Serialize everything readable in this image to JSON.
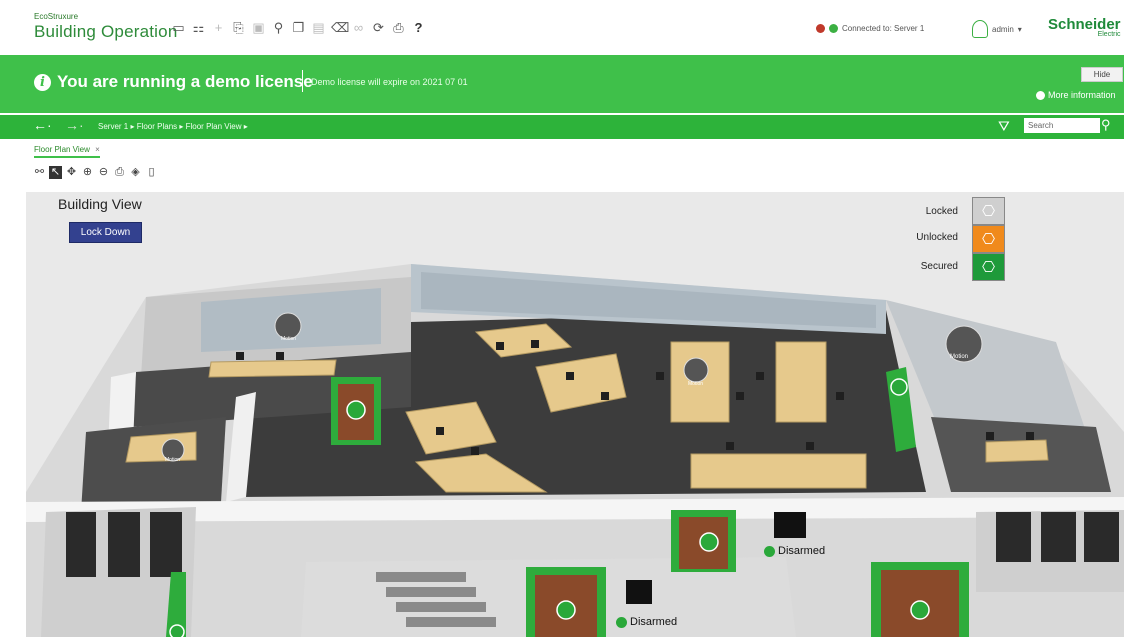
{
  "header": {
    "brand_small": "EcoStruxure",
    "brand": "Building Operation",
    "connection": "Connected to: Server 1",
    "user": "admin",
    "logo": "Schneider",
    "logo_sub": "Electric",
    "toolbar_icons": [
      "monitor-icon",
      "columns-icon",
      "plus-icon",
      "open-icon",
      "save-icon",
      "network-icon",
      "copy-icon",
      "paste-icon",
      "delete-icon",
      "link-icon",
      "refresh-icon",
      "print-icon",
      "help-icon"
    ]
  },
  "banner": {
    "title": "You are running a demo license",
    "subtitle": "Demo license will expire on 2021 07 01",
    "hide_label": "Hide",
    "more_info": "More information"
  },
  "nav": {
    "breadcrumb": "Server 1 ▸  Floor Plans ▸  Floor Plan View ▸",
    "search_placeholder": "Search"
  },
  "tab": {
    "label": "Floor Plan View",
    "close": "×"
  },
  "view": {
    "title": "Building View",
    "lockdown_label": "Lock Down",
    "legend": [
      {
        "label": "Locked",
        "color": "#cfcfcf"
      },
      {
        "label": "Unlocked",
        "color": "#f08a1c"
      },
      {
        "label": "Secured",
        "color": "#1e9a3a"
      }
    ],
    "zones": [
      "Motion",
      "Motion",
      "Motion",
      "Motion"
    ],
    "alarm_status_1": "Disarmed",
    "alarm_status_2": "Disarmed"
  },
  "colors": {
    "accent": "#3fc04a",
    "nav": "#2db33a",
    "lockdown": "#33418f"
  }
}
